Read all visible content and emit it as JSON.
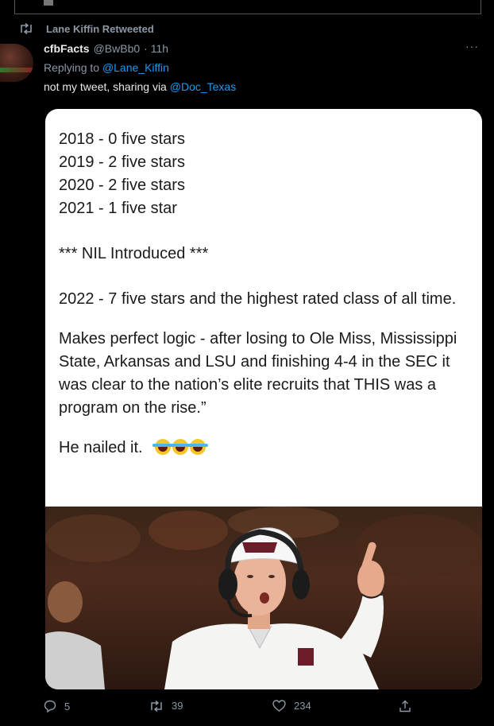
{
  "retweet": {
    "label": "Lane Kiffin Retweeted"
  },
  "tweet": {
    "author_name": "cfbFacts",
    "author_handle": "@BwBb0",
    "time": "· 11h",
    "replying_prefix": "Replying to",
    "replying_to": "@Lane_Kiffin",
    "text_prefix": "not my tweet, sharing via",
    "text_mention": "@Doc_Texas"
  },
  "card": {
    "lines": [
      "2018 - 0 five stars",
      "2019 - 2 five stars",
      "2020 - 2 five stars",
      "2021 - 1 five star"
    ],
    "nil_line": "*** NIL Introduced ***",
    "line_2022": "2022 - 7 five stars and the highest rated class of all time.",
    "paragraph": "Makes perfect logic - after losing to Ole Miss, Mississippi State, Arkansas and LSU and finishing 4-4 in the SEC it was clear to the nation’s elite recruits that THIS was a program on the rise.”",
    "closing": "He nailed it."
  },
  "actions": {
    "replies": "5",
    "retweets": "39",
    "likes": "234"
  },
  "colors": {
    "accent": "#1d9bf0",
    "muted": "#8b98a5",
    "background": "#000000"
  },
  "icons": [
    "retweet-icon",
    "more-icon",
    "reply-icon",
    "like-icon",
    "share-icon",
    "laughing-emoji-icon"
  ]
}
